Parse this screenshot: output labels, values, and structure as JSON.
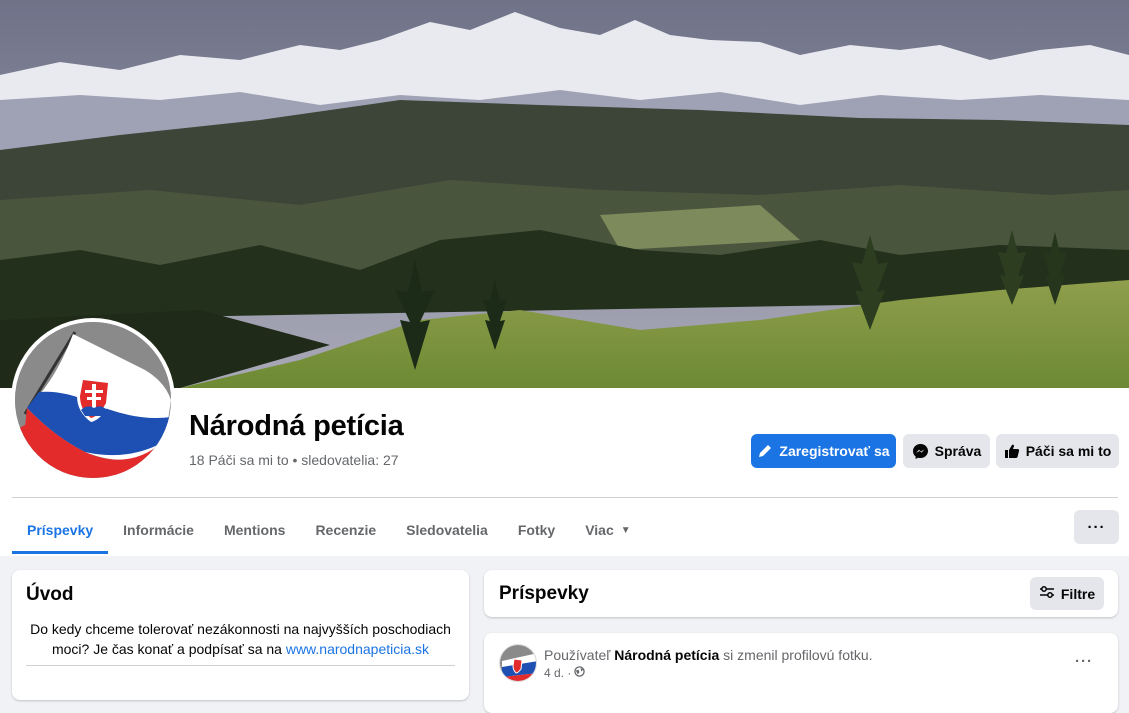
{
  "page": {
    "name": "Národná petícia",
    "stats": "18 Páči sa mi to • sledovatelia: 27"
  },
  "actions": {
    "register_label": "Zaregistrovať sa",
    "message_label": "Správa",
    "like_label": "Páči sa mi to"
  },
  "tabs": [
    {
      "label": "Príspevky",
      "active": true
    },
    {
      "label": "Informácie"
    },
    {
      "label": "Mentions"
    },
    {
      "label": "Recenzie"
    },
    {
      "label": "Sledovatelia"
    },
    {
      "label": "Fotky"
    },
    {
      "label": "Viac"
    }
  ],
  "more_button": "···",
  "intro": {
    "title": "Úvod",
    "text": "Do kedy chceme tolerovať nezákonnosti na najvyšších poschodiach moci? Je čas konať a podpísať sa na",
    "link": "www.narodnapeticia.sk"
  },
  "posts": {
    "title": "Príspevky",
    "filter_label": "Filtre"
  },
  "post": {
    "prefix": "Používateľ",
    "author": "Národná petícia",
    "action": "si zmenil profilovú fotku.",
    "time": "4 d. ·",
    "menu": "···"
  },
  "colors": {
    "accent": "#1b74e4",
    "secondary_button": "#e4e6eb",
    "background": "#f0f2f5"
  },
  "icons": {
    "register": "pencil-icon",
    "message": "messenger-icon",
    "like": "thumbs-up-icon",
    "filter": "sliders-icon",
    "privacy": "globe-icon"
  }
}
